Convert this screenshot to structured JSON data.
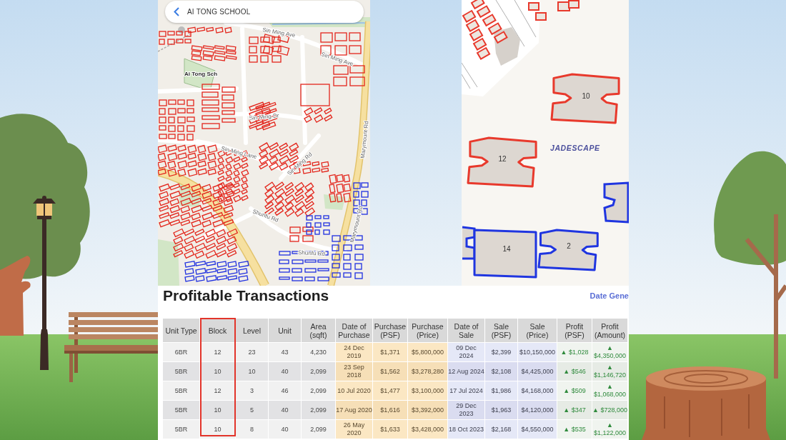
{
  "map_left": {
    "search": {
      "value": "AI TONG SCHOOL"
    },
    "place_label": "Ai Tong Sch",
    "street_labels": [
      "Sin Ming Ave",
      "Sin Ming Ave",
      "Sin Ming Dr",
      "Sin Ming Lane",
      "Sin Ming Rd",
      "Shunfu Rd",
      "Shunfu Rd",
      "Marymount Rd",
      "Marymount Rd"
    ]
  },
  "map_right": {
    "estate_label": "JADESCAPE",
    "blocks": [
      {
        "label": "10",
        "color": "#e8392c"
      },
      {
        "label": "12",
        "color": "#e8392c"
      },
      {
        "label": "14",
        "color": "#1f35e0"
      },
      {
        "label": "2",
        "color": "#1f35e0"
      }
    ]
  },
  "transactions": {
    "title": "Profitable Transactions",
    "date_note": "Date Gene",
    "columns": [
      {
        "label": "Unit Type",
        "kind": "general",
        "highlight": false
      },
      {
        "label": "Block",
        "kind": "general",
        "highlight": true
      },
      {
        "label": "Level",
        "kind": "general",
        "highlight": false
      },
      {
        "label": "Unit",
        "kind": "general",
        "highlight": false
      },
      {
        "label": "Area (sqft)",
        "kind": "general",
        "highlight": false
      },
      {
        "label": "Date of Purchase",
        "kind": "purchase",
        "highlight": false
      },
      {
        "label": "Purchase (PSF)",
        "kind": "purchase",
        "highlight": false
      },
      {
        "label": "Purchase (Price)",
        "kind": "purchase",
        "highlight": false
      },
      {
        "label": "Date of Sale",
        "kind": "sale",
        "highlight": false
      },
      {
        "label": "Sale (PSF)",
        "kind": "sale",
        "highlight": false
      },
      {
        "label": "Sale (Price)",
        "kind": "sale",
        "highlight": false
      },
      {
        "label": "Profit (PSF)",
        "kind": "profit",
        "highlight": false
      },
      {
        "label": "Profit (Amount)",
        "kind": "profit",
        "highlight": false
      }
    ],
    "rows": [
      [
        "6BR",
        "12",
        "23",
        "43",
        "4,230",
        "24 Dec 2019",
        "$1,371",
        "$5,800,000",
        "09 Dec 2024",
        "$2,399",
        "$10,150,000",
        "▲ $1,028",
        "▲ $4,350,000"
      ],
      [
        "5BR",
        "10",
        "10",
        "40",
        "2,099",
        "23 Sep 2018",
        "$1,562",
        "$3,278,280",
        "12 Aug 2024",
        "$2,108",
        "$4,425,000",
        "▲ $546",
        "▲ $1,146,720"
      ],
      [
        "5BR",
        "12",
        "3",
        "46",
        "2,099",
        "10 Jul 2020",
        "$1,477",
        "$3,100,000",
        "17 Jul 2024",
        "$1,986",
        "$4,168,000",
        "▲ $509",
        "▲ $1,068,000"
      ],
      [
        "5BR",
        "10",
        "5",
        "40",
        "2,099",
        "17 Aug 2020",
        "$1,616",
        "$3,392,000",
        "29 Dec 2023",
        "$1,963",
        "$4,120,000",
        "▲ $347",
        "▲ $728,000"
      ],
      [
        "5BR",
        "10",
        "8",
        "40",
        "2,099",
        "26 May 2020",
        "$1,633",
        "$3,428,000",
        "18 Oct 2023",
        "$2,168",
        "$4,550,000",
        "▲ $535",
        "▲ $1,122,000"
      ]
    ]
  }
}
